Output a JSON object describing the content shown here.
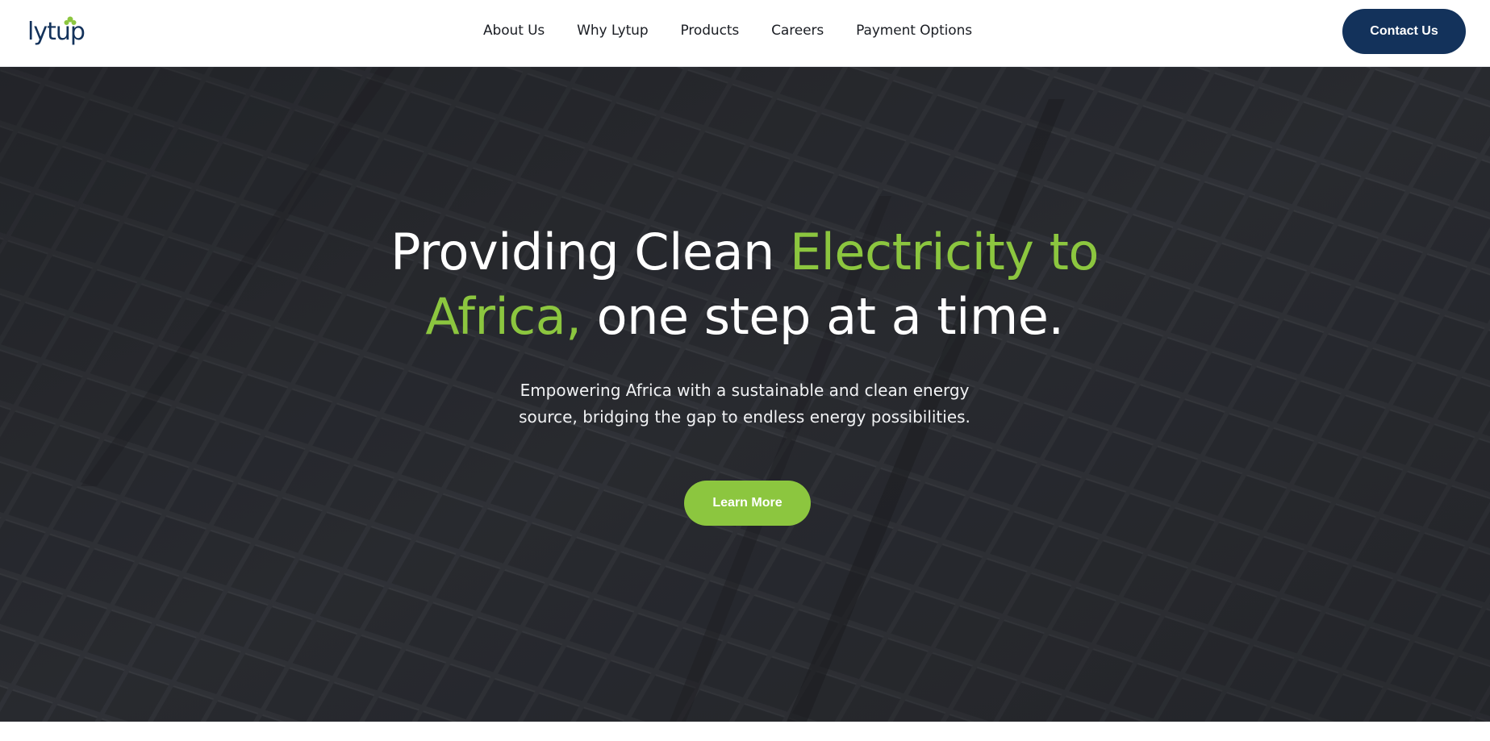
{
  "brand": {
    "logo_text": "lytup",
    "primary_color": "#13325b",
    "accent_color": "#8cc63f"
  },
  "nav": {
    "items": [
      {
        "label": "About Us"
      },
      {
        "label": "Why Lytup"
      },
      {
        "label": "Products"
      },
      {
        "label": "Careers"
      },
      {
        "label": "Payment Options"
      }
    ],
    "contact_label": "Contact Us"
  },
  "hero": {
    "background": "solar-panel-field-photo",
    "headline_part1": "Providing Clean ",
    "headline_accent1": "Electricity to",
    "headline_accent2": "Africa,",
    "headline_part2": " one step at a time.",
    "subtext_line1": "Empowering Africa with a sustainable and clean energy",
    "subtext_line2": "source, bridging the gap to endless energy possibilities.",
    "cta_label": "Learn More"
  }
}
